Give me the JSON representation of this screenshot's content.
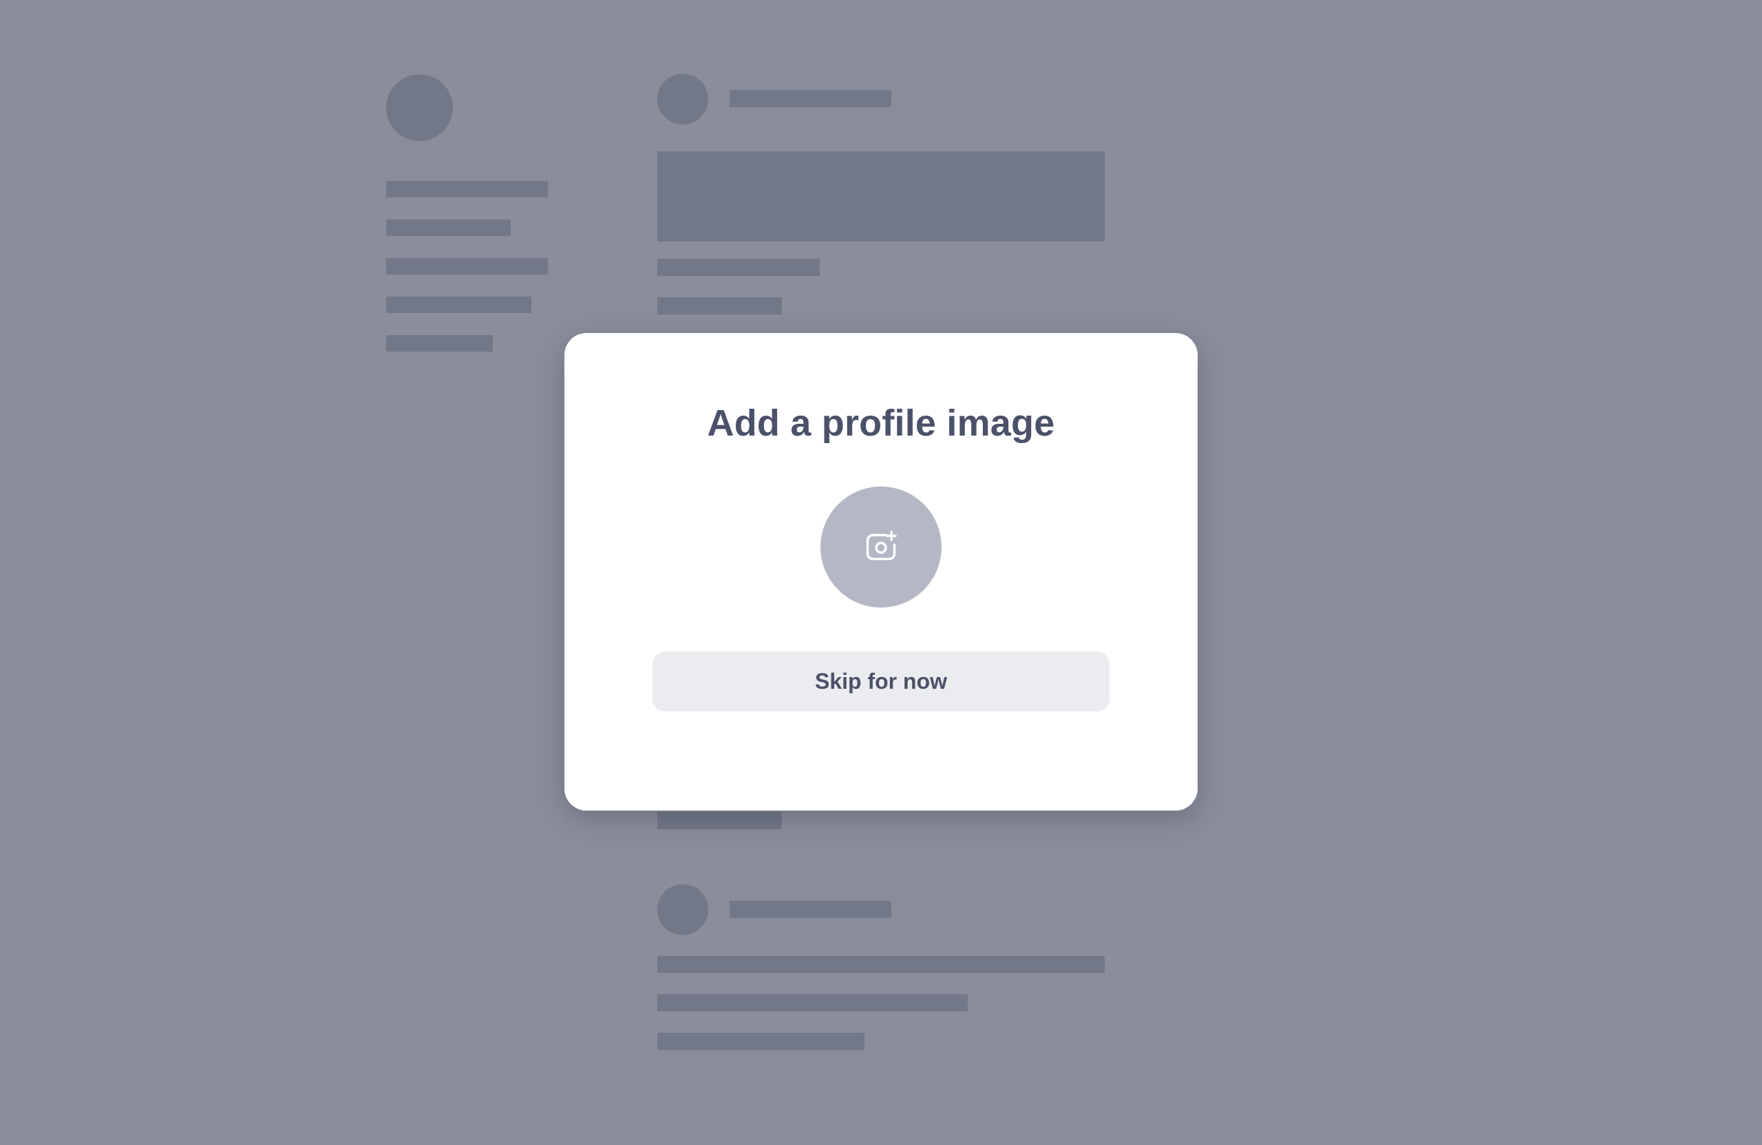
{
  "background": {
    "overlay_color": "#8a8d9b",
    "skeleton_color": "#737888"
  },
  "modal": {
    "title": "Add a profile image",
    "upload_button": {
      "icon": "camera-plus-icon",
      "background_color": "#b5b8c4"
    },
    "skip_button": {
      "label": "Skip for now",
      "background_color": "#ebecef"
    },
    "text_color": "#4b5168"
  }
}
